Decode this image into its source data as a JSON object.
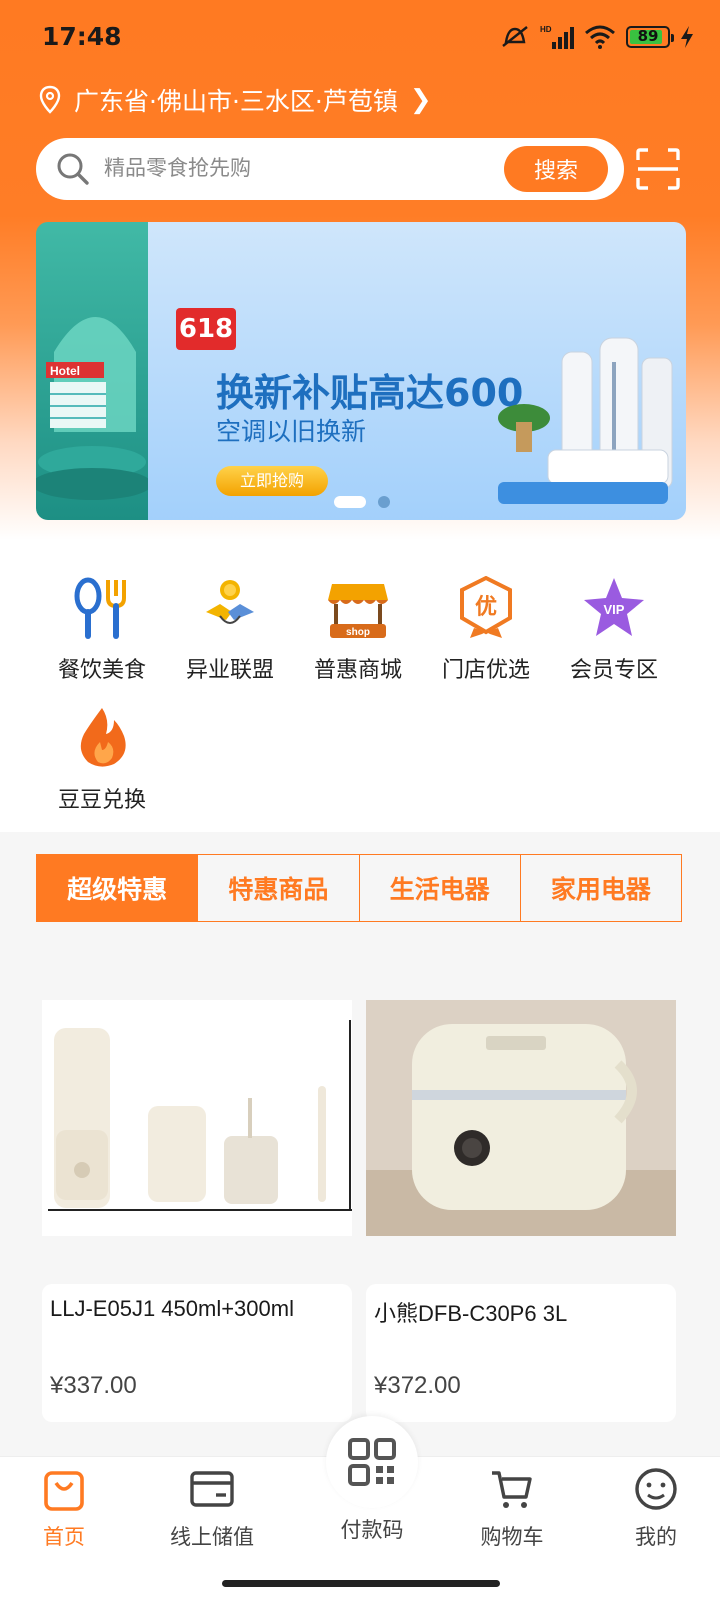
{
  "status_bar": {
    "time": "17:48",
    "battery": "89",
    "network": "HD"
  },
  "location": {
    "text": "广东省·佛山市·三水区·芦苞镇"
  },
  "search": {
    "placeholder": "精品零食抢先购",
    "button_label": "搜索"
  },
  "banner": {
    "badge": "618",
    "title": "换新补贴高达600",
    "subtitle": "空调以旧换新",
    "cta": "立即抢购",
    "left_sign": "Hotel"
  },
  "categories": [
    {
      "label": "餐饮美食",
      "icon": "utensils-icon"
    },
    {
      "label": "异业联盟",
      "icon": "handshake-icon"
    },
    {
      "label": "普惠商城",
      "icon": "shop-icon"
    },
    {
      "label": "门店优选",
      "icon": "premium-badge-icon"
    },
    {
      "label": "会员专区",
      "icon": "vip-star-icon"
    },
    {
      "label": "豆豆兑换",
      "icon": "flame-icon"
    }
  ],
  "category_icon_text": {
    "shop": "shop",
    "premium": "优",
    "vip": "VIP"
  },
  "tabs": [
    "超级特惠",
    "特惠商品",
    "生活电器",
    "家用电器"
  ],
  "products": [
    {
      "name": "LLJ-E05J1 450ml+300ml",
      "price": "¥337.00",
      "image": "blender-set-image"
    },
    {
      "name": "小熊DFB-C30P6 3L",
      "price": "¥372.00",
      "image": "rice-cooker-image"
    }
  ],
  "bottom_nav": [
    {
      "label": "首页",
      "icon": "shopping-bag-icon"
    },
    {
      "label": "线上储值",
      "icon": "wallet-card-icon"
    },
    {
      "label": "付款码",
      "icon": "qr-code-icon"
    },
    {
      "label": "购物车",
      "icon": "cart-icon"
    },
    {
      "label": "我的",
      "icon": "smile-profile-icon"
    }
  ],
  "colors": {
    "accent": "#ff7a22",
    "tab_text": "#ff7a22",
    "banner_text": "#1e6fbf",
    "price": "#444444"
  }
}
